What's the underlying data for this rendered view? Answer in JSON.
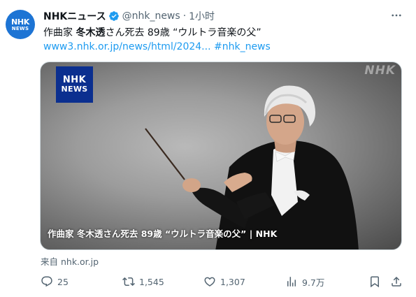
{
  "author": {
    "display_name": "NHKニュース",
    "handle": "@nhk_news",
    "separator": "·",
    "time": "1小时",
    "avatar": {
      "line1": "NHK",
      "line2": "NEWS",
      "color": "#1d74d4"
    },
    "verified_color": "#1d9bf0"
  },
  "tweet": {
    "text_prefix": "作曲家 ",
    "text_bold": "冬木透",
    "text_suffix": "さん死去 89歳 “ウルトラ音楽の父”",
    "link_url": "www3.nhk.or.jp/news/html/2024...",
    "hashtag": "#nhk_news"
  },
  "media": {
    "logo_line1": "NHK",
    "logo_line2": "NEWS",
    "watermark": "NHK",
    "caption": "作曲家 冬木透さん死去 89歳 “ウルトラ音楽の父” | NHK",
    "logo_color": "#0b2f8f"
  },
  "source": "来自 nhk.or.jp",
  "actions": {
    "replies": "25",
    "retweets": "1,545",
    "likes": "1,307",
    "views": "9.7万"
  },
  "colors": {
    "accent": "#1d9bf0",
    "muted": "#536471",
    "text": "#0f1419"
  }
}
